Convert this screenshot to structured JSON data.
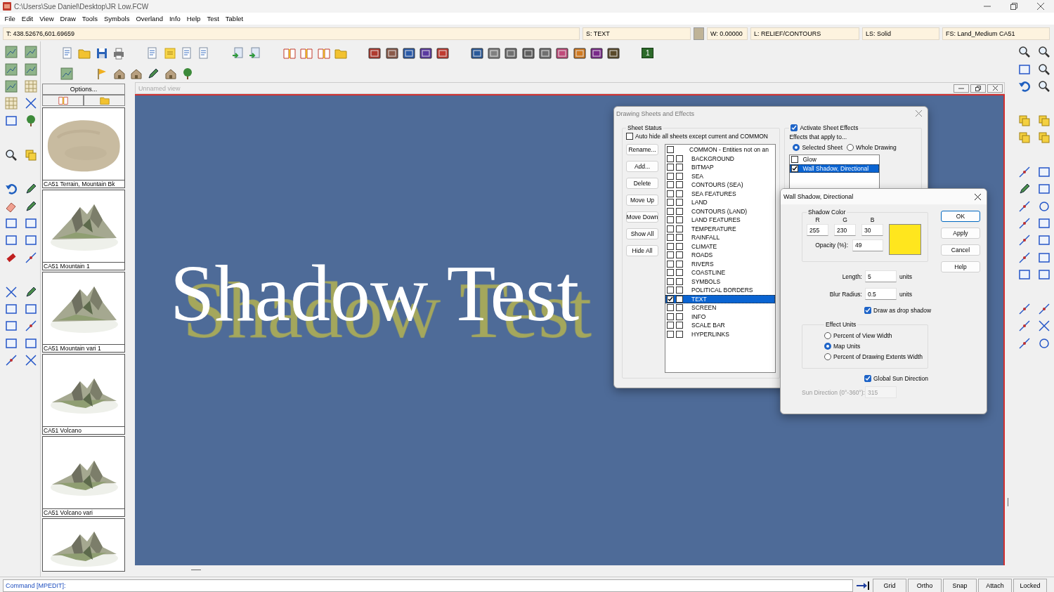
{
  "window": {
    "title": "C:\\Users\\Sue Daniel\\Desktop\\JR Low.FCW"
  },
  "menu": [
    "File",
    "Edit",
    "View",
    "Draw",
    "Tools",
    "Symbols",
    "Overland",
    "Info",
    "Help",
    "Test",
    "Tablet"
  ],
  "status_fields": [
    {
      "kind": "field",
      "text": "T: 438.52676,601.69659"
    },
    {
      "kind": "field",
      "text": "S: TEXT"
    },
    {
      "kind": "swatch",
      "color": "#bfb397"
    },
    {
      "kind": "field",
      "text": "W: 0.00000"
    },
    {
      "kind": "field",
      "text": "L: RELIEF/CONTOURS"
    },
    {
      "kind": "field",
      "text": "LS: Solid"
    },
    {
      "kind": "field",
      "text": "FS: Land_Medium CA51"
    }
  ],
  "layer_button": "1",
  "symbol_panel": {
    "options_button": "Options...",
    "symbols": [
      {
        "kind": "picture",
        "caption": "CA51 Terrain, Mountain Bk"
      },
      {
        "kind": "picture",
        "caption": "CA51 Mountain 1"
      },
      {
        "kind": "picture",
        "caption": "CA51 Mountain vari 1"
      },
      {
        "kind": "picture",
        "caption": "CA51 Volcano"
      },
      {
        "kind": "picture",
        "caption": "CA51 Volcano vari"
      },
      {
        "kind": "picture"
      }
    ]
  },
  "view": {
    "title": "Unnamed view",
    "canvas_text": "Shadow Test"
  },
  "sheets_dialog": {
    "title": "Drawing Sheets and Effects",
    "group_label": "Sheet Status",
    "auto_hide": {
      "label": "Auto hide all sheets except current and COMMON",
      "checked": false
    },
    "buttons": [
      "Rename...",
      "Add...",
      "Delete",
      "Move Up",
      "Move Down",
      "Show All",
      "Hide All"
    ],
    "sheets": [
      {
        "kind": "common",
        "name": "COMMON - Entities not on an",
        "checked": false,
        "selected": false
      },
      {
        "kind": "sheet",
        "name": "BACKGROUND",
        "checked": false,
        "effects_checked": false,
        "selected": false
      },
      {
        "kind": "sheet",
        "name": "BITMAP",
        "checked": false,
        "effects_checked": false,
        "selected": false
      },
      {
        "kind": "sheet",
        "name": "SEA",
        "checked": false,
        "effects_checked": false,
        "selected": false
      },
      {
        "kind": "sheet",
        "name": "CONTOURS (SEA)",
        "checked": false,
        "effects_checked": false,
        "selected": false
      },
      {
        "kind": "sheet",
        "name": "SEA FEATURES",
        "checked": false,
        "effects_checked": false,
        "selected": false
      },
      {
        "kind": "sheet",
        "name": "LAND",
        "checked": false,
        "effects_checked": false,
        "selected": false
      },
      {
        "kind": "sheet",
        "name": "CONTOURS (LAND)",
        "checked": false,
        "effects_checked": false,
        "selected": false
      },
      {
        "kind": "sheet",
        "name": "LAND FEATURES",
        "checked": false,
        "effects_checked": false,
        "selected": false
      },
      {
        "kind": "sheet",
        "name": "TEMPERATURE",
        "checked": false,
        "effects_checked": false,
        "selected": false
      },
      {
        "kind": "sheet",
        "name": "RAINFALL",
        "checked": false,
        "effects_checked": false,
        "selected": false
      },
      {
        "kind": "sheet",
        "name": "CLIMATE",
        "checked": false,
        "effects_checked": false,
        "selected": false
      },
      {
        "kind": "sheet",
        "name": "ROADS",
        "checked": false,
        "effects_checked": false,
        "selected": false
      },
      {
        "kind": "sheet",
        "name": "RIVERS",
        "checked": false,
        "effects_checked": false,
        "selected": false
      },
      {
        "kind": "sheet",
        "name": "COASTLINE",
        "checked": false,
        "effects_checked": false,
        "selected": false
      },
      {
        "kind": "sheet",
        "name": "SYMBOLS",
        "checked": false,
        "effects_checked": false,
        "selected": false
      },
      {
        "kind": "sheet",
        "name": "POLITICAL BORDERS",
        "checked": false,
        "effects_checked": false,
        "selected": false
      },
      {
        "kind": "sheet",
        "name": "TEXT",
        "checked": true,
        "effects_checked": false,
        "selected": true
      },
      {
        "kind": "sheet",
        "name": "SCREEN",
        "checked": false,
        "effects_checked": false,
        "selected": false
      },
      {
        "kind": "sheet",
        "name": "INFO",
        "checked": false,
        "effects_checked": false,
        "selected": false
      },
      {
        "kind": "sheet",
        "name": "SCALE BAR",
        "checked": false,
        "effects_checked": false,
        "selected": false
      },
      {
        "kind": "sheet",
        "name": "HYPERLINKS",
        "checked": false,
        "effects_checked": false,
        "selected": false
      }
    ],
    "activate_effects": {
      "label": "Activate Sheet Effects",
      "checked": true
    },
    "apply_to_label": "Effects that apply to...",
    "apply_to": [
      {
        "label": "Selected Sheet",
        "selected": true
      },
      {
        "label": "Whole Drawing",
        "selected": false
      }
    ],
    "effects": [
      {
        "name": "Glow",
        "checked": false,
        "selected": false
      },
      {
        "name": "Wall Shadow, Directional",
        "checked": true,
        "selected": true
      }
    ]
  },
  "shadow_dialog": {
    "title": "Wall Shadow, Directional",
    "color_group": "Shadow Color",
    "channels": [
      {
        "label": "R",
        "value": "255"
      },
      {
        "label": "G",
        "value": "230"
      },
      {
        "label": "B",
        "value": "30"
      }
    ],
    "opacity_label": "Opacity (%):",
    "opacity": "49",
    "length_label": "Length:",
    "length": "5",
    "length_units": "units",
    "blur_label": "Blur Radius:",
    "blur": "0.5",
    "blur_units": "units",
    "drop_shadow": {
      "label": "Draw as drop shadow",
      "checked": true
    },
    "units_group": "Effect Units",
    "units": [
      {
        "label": "Percent of View Width",
        "selected": false
      },
      {
        "label": "Map Units",
        "selected": true
      },
      {
        "label": "Percent of Drawing Extents Width",
        "selected": false
      }
    ],
    "global_sun": {
      "label": "Global Sun Direction",
      "checked": true
    },
    "sun_label": "Sun Direction (0°-360°):",
    "sun_value": "315",
    "sun_disabled": true,
    "buttons": [
      "OK",
      "Apply",
      "Cancel",
      "Help"
    ]
  },
  "command_line": "Command [MPEDIT]:",
  "toggles": [
    "Grid",
    "Ortho",
    "Snap",
    "Attach",
    "Locked"
  ]
}
